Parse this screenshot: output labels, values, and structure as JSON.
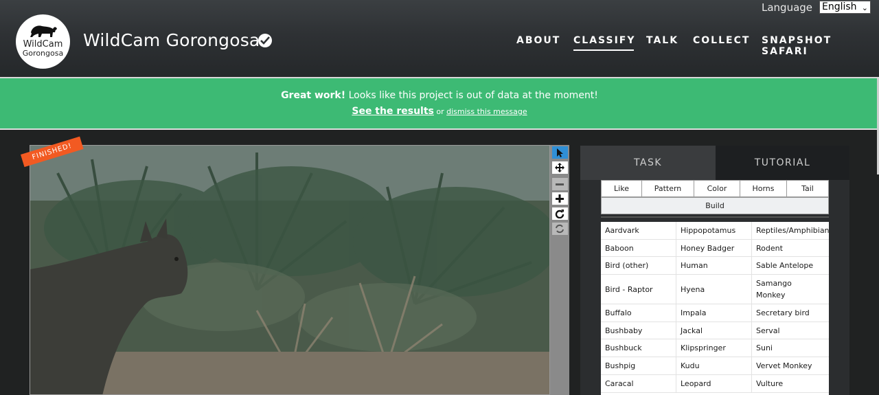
{
  "header": {
    "site_title": "WildCam Gorongosa",
    "logo_line1": "WildCam",
    "logo_line2": "Gorongosa",
    "language_label": "Language",
    "language_selected": "English",
    "nav": [
      {
        "label": "ABOUT"
      },
      {
        "label": "CLASSIFY",
        "active": true
      },
      {
        "label": "TALK"
      },
      {
        "label": "COLLECT"
      },
      {
        "label": "SNAPSHOT SAFARI"
      }
    ]
  },
  "banner": {
    "strong": "Great work!",
    "message": " Looks like this project is out of data at the moment!",
    "results_link": "See the results",
    "or_text": " or ",
    "dismiss_link": "dismiss this message"
  },
  "viewer": {
    "finished_label": "FINISHED!",
    "tools": [
      "cursor-icon",
      "move-icon",
      "zoom-out-icon",
      "zoom-in-icon",
      "rotate-icon",
      "reset-icon"
    ]
  },
  "task_panel": {
    "tabs": [
      {
        "label": "TASK"
      },
      {
        "label": "TUTORIAL"
      }
    ],
    "filters": [
      "Like",
      "Pattern",
      "Color",
      "Horns",
      "Tail"
    ],
    "build_label": "Build",
    "species_rows": [
      [
        "Aardvark",
        "Hippopotamus",
        "Reptiles/Amphibians"
      ],
      [
        "Baboon",
        "Honey Badger",
        "Rodent"
      ],
      [
        "Bird (other)",
        "Human",
        "Sable Antelope"
      ],
      [
        "Bird - Raptor",
        "Hyena",
        "Samango Monkey"
      ],
      [
        "Buffalo",
        "Impala",
        "Secretary bird"
      ],
      [
        "Bushbaby",
        "Jackal",
        "Serval"
      ],
      [
        "Bushbuck",
        "Klipspringer",
        "Suni"
      ],
      [
        "Bushpig",
        "Kudu",
        "Vervet Monkey"
      ],
      [
        "Caracal",
        "Leopard",
        "Vulture"
      ]
    ]
  },
  "colors": {
    "banner_green": "#3dba74",
    "finished_orange": "#f25a22",
    "tool_active_blue": "#2f8fd6"
  }
}
